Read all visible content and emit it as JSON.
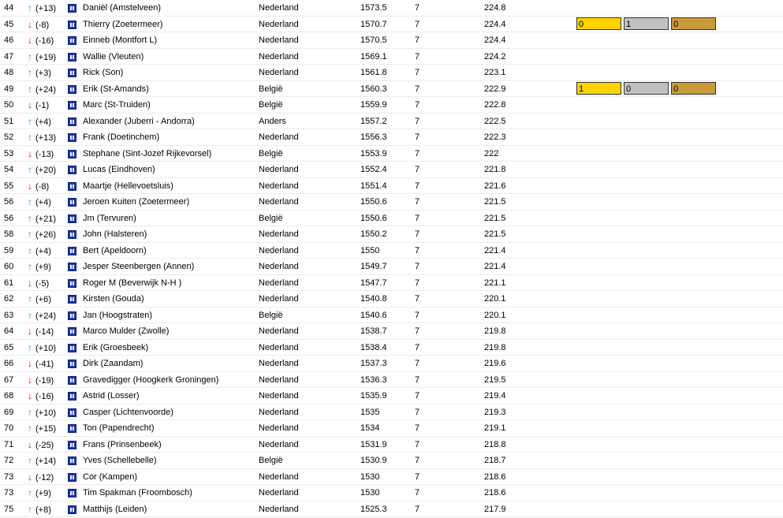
{
  "colors": {
    "up_arrow": "#00c000",
    "down_arrow": "#e00000",
    "flag_icon": "#1c3aa8",
    "gold": "#ffd200",
    "silver": "#c0c0c0",
    "bronze": "#c89a3c"
  },
  "rows": [
    {
      "rank": "44",
      "dir": "up",
      "delta": "(+13)",
      "name": "Daniël (Amstelveen)",
      "country": "Nederland",
      "score": "1573.5",
      "games": "7",
      "avg": "224.8"
    },
    {
      "rank": "45",
      "dir": "down",
      "delta": "(-8)",
      "name": "Thierry (Zoetermeer)",
      "country": "Nederland",
      "score": "1570.7",
      "games": "7",
      "avg": "224.4",
      "medals": {
        "gold": "0",
        "silver": "1",
        "bronze": "0"
      }
    },
    {
      "rank": "46",
      "dir": "down",
      "delta": "(-16)",
      "name": "Einneb (Montfort L)",
      "country": "Nederland",
      "score": "1570.5",
      "games": "7",
      "avg": "224.4"
    },
    {
      "rank": "47",
      "dir": "up",
      "delta": "(+19)",
      "name": "Wallie (Vleuten)",
      "country": "Nederland",
      "score": "1569.1",
      "games": "7",
      "avg": "224.2"
    },
    {
      "rank": "48",
      "dir": "up",
      "delta": "(+3)",
      "name": "Rick (Son)",
      "country": "Nederland",
      "score": "1561.8",
      "games": "7",
      "avg": "223.1"
    },
    {
      "rank": "49",
      "dir": "up",
      "delta": "(+24)",
      "name": "Erik (St-Amands)",
      "country": "België",
      "score": "1560.3",
      "games": "7",
      "avg": "222.9",
      "medals": {
        "gold": "1",
        "silver": "0",
        "bronze": "0"
      }
    },
    {
      "rank": "50",
      "dir": "down",
      "delta": "(-1)",
      "name": "Marc (St-Truiden)",
      "country": "België",
      "score": "1559.9",
      "games": "7",
      "avg": "222.8"
    },
    {
      "rank": "51",
      "dir": "up",
      "delta": "(+4)",
      "name": "Alexander (Juberri - Andorra)",
      "country": "Anders",
      "score": "1557.2",
      "games": "7",
      "avg": "222.5"
    },
    {
      "rank": "52",
      "dir": "up",
      "delta": "(+13)",
      "name": "Frank (Doetinchem)",
      "country": "Nederland",
      "score": "1556.3",
      "games": "7",
      "avg": "222.3"
    },
    {
      "rank": "53",
      "dir": "down",
      "delta": "(-13)",
      "name": "Stephane (Sint-Jozef Rijkevorsel)",
      "country": "België",
      "score": "1553.9",
      "games": "7",
      "avg": "222"
    },
    {
      "rank": "54",
      "dir": "up",
      "delta": "(+20)",
      "name": "Lucas (Eindhoven)",
      "country": "Nederland",
      "score": "1552.4",
      "games": "7",
      "avg": "221.8"
    },
    {
      "rank": "55",
      "dir": "down",
      "delta": "(-8)",
      "name": "Maartje (Hellevoetsluis)",
      "country": "Nederland",
      "score": "1551.4",
      "games": "7",
      "avg": "221.6"
    },
    {
      "rank": "56",
      "dir": "up",
      "delta": "(+4)",
      "name": "Jeroen Kuiten (Zoetermeer)",
      "country": "Nederland",
      "score": "1550.6",
      "games": "7",
      "avg": "221.5"
    },
    {
      "rank": "56",
      "dir": "up",
      "delta": "(+21)",
      "name": "Jm (Tervuren)",
      "country": "België",
      "score": "1550.6",
      "games": "7",
      "avg": "221.5"
    },
    {
      "rank": "58",
      "dir": "up",
      "delta": "(+26)",
      "name": "John (Halsteren)",
      "country": "Nederland",
      "score": "1550.2",
      "games": "7",
      "avg": "221.5"
    },
    {
      "rank": "59",
      "dir": "up",
      "delta": "(+4)",
      "name": "Bert (Apeldoorn)",
      "country": "Nederland",
      "score": "1550",
      "games": "7",
      "avg": "221.4"
    },
    {
      "rank": "60",
      "dir": "up",
      "delta": "(+9)",
      "name": "Jesper Steenbergen (Annen)",
      "country": "Nederland",
      "score": "1549.7",
      "games": "7",
      "avg": "221.4"
    },
    {
      "rank": "61",
      "dir": "down",
      "delta": "(-5)",
      "name": "Roger M (Beverwijk N-H )",
      "country": "Nederland",
      "score": "1547.7",
      "games": "7",
      "avg": "221.1"
    },
    {
      "rank": "62",
      "dir": "up",
      "delta": "(+6)",
      "name": "Kirsten (Gouda)",
      "country": "Nederland",
      "score": "1540.8",
      "games": "7",
      "avg": "220.1"
    },
    {
      "rank": "63",
      "dir": "up",
      "delta": "(+24)",
      "name": "Jan (Hoogstraten)",
      "country": "België",
      "score": "1540.6",
      "games": "7",
      "avg": "220.1"
    },
    {
      "rank": "64",
      "dir": "down",
      "delta": "(-14)",
      "name": "Marco Mulder (Zwolle)",
      "country": "Nederland",
      "score": "1538.7",
      "games": "7",
      "avg": "219.8"
    },
    {
      "rank": "65",
      "dir": "up",
      "delta": "(+10)",
      "name": "Erik (Groesbeek)",
      "country": "Nederland",
      "score": "1538.4",
      "games": "7",
      "avg": "219.8"
    },
    {
      "rank": "66",
      "dir": "down",
      "delta": "(-41)",
      "name": "Dirk (Zaandam)",
      "country": "Nederland",
      "score": "1537.3",
      "games": "7",
      "avg": "219.6"
    },
    {
      "rank": "67",
      "dir": "down",
      "delta": "(-19)",
      "name": "Gravedigger (Hoogkerk Groningen)",
      "country": "Nederland",
      "score": "1536.3",
      "games": "7",
      "avg": "219.5"
    },
    {
      "rank": "68",
      "dir": "down",
      "delta": "(-16)",
      "name": "Astrid (Losser)",
      "country": "Nederland",
      "score": "1535.9",
      "games": "7",
      "avg": "219.4"
    },
    {
      "rank": "69",
      "dir": "up",
      "delta": "(+10)",
      "name": "Casper (Lichtenvoorde)",
      "country": "Nederland",
      "score": "1535",
      "games": "7",
      "avg": "219.3"
    },
    {
      "rank": "70",
      "dir": "up",
      "delta": "(+15)",
      "name": "Ton (Papendrecht)",
      "country": "Nederland",
      "score": "1534",
      "games": "7",
      "avg": "219.1"
    },
    {
      "rank": "71",
      "dir": "down",
      "delta": "(-25)",
      "name": "Frans (Prinsenbeek)",
      "country": "Nederland",
      "score": "1531.9",
      "games": "7",
      "avg": "218.8"
    },
    {
      "rank": "72",
      "dir": "up",
      "delta": "(+14)",
      "name": "Yves (Schellebelle)",
      "country": "België",
      "score": "1530.9",
      "games": "7",
      "avg": "218.7"
    },
    {
      "rank": "73",
      "dir": "down",
      "delta": "(-12)",
      "name": "Cor (Kampen)",
      "country": "Nederland",
      "score": "1530",
      "games": "7",
      "avg": "218.6"
    },
    {
      "rank": "73",
      "dir": "up",
      "delta": "(+9)",
      "name": "Tim Spakman (Froombosch)",
      "country": "Nederland",
      "score": "1530",
      "games": "7",
      "avg": "218.6"
    },
    {
      "rank": "75",
      "dir": "up",
      "delta": "(+8)",
      "name": "Matthijs (Leiden)",
      "country": "Nederland",
      "score": "1525.3",
      "games": "7",
      "avg": "217.9"
    }
  ]
}
